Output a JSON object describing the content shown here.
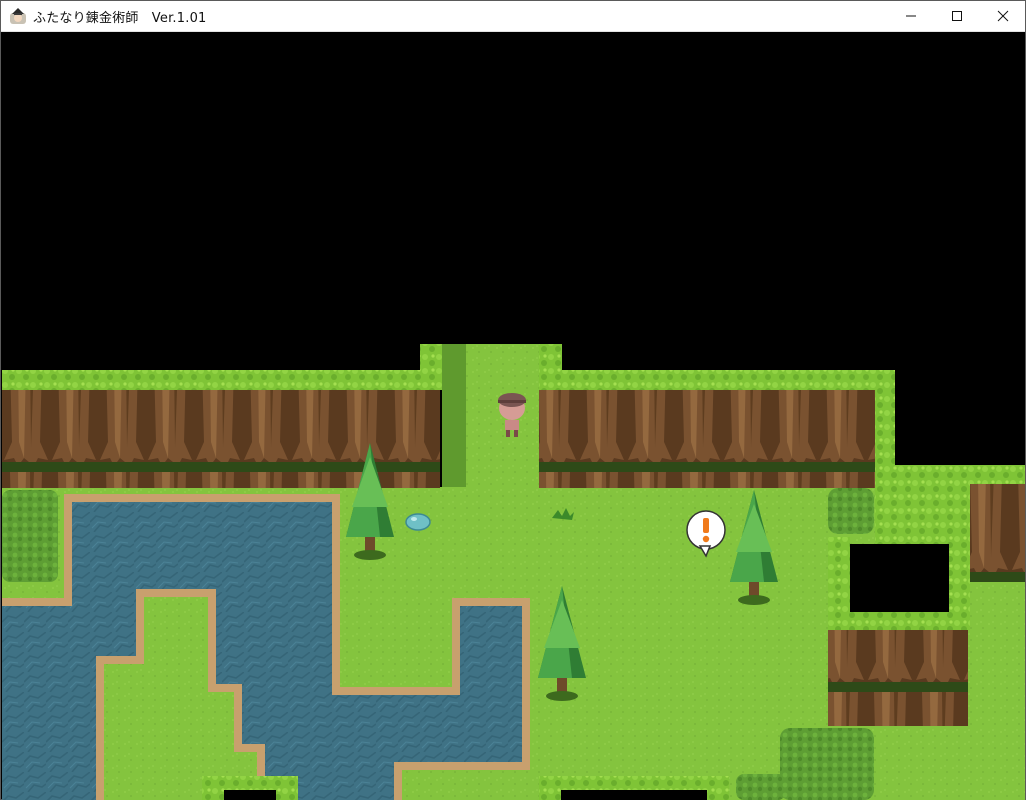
{
  "window": {
    "title": "ふたなり錬金術師　Ver.1.01",
    "app_icon": "alchemist-character-icon",
    "controls": {
      "minimize": "minimize-icon",
      "maximize": "maximize-icon",
      "close": "close-icon"
    }
  },
  "game": {
    "scene": "forest-field-map",
    "map_entities": {
      "player": "pink-haired-girl-sprite",
      "slime": "blue-slime-sprite",
      "event_marker": "exclamation-speech-balloon",
      "trees": [
        "conifer-tree",
        "conifer-tree",
        "conifer-tree"
      ],
      "plant": "small-weed"
    },
    "colors": {
      "void": "#000000",
      "grass": "#84c43e",
      "hedge_top": "#7fc436",
      "water": "#3f7285",
      "shore": "#c8a06e",
      "trunk": "#6e4a2a",
      "alert": "#f07a1a"
    }
  }
}
